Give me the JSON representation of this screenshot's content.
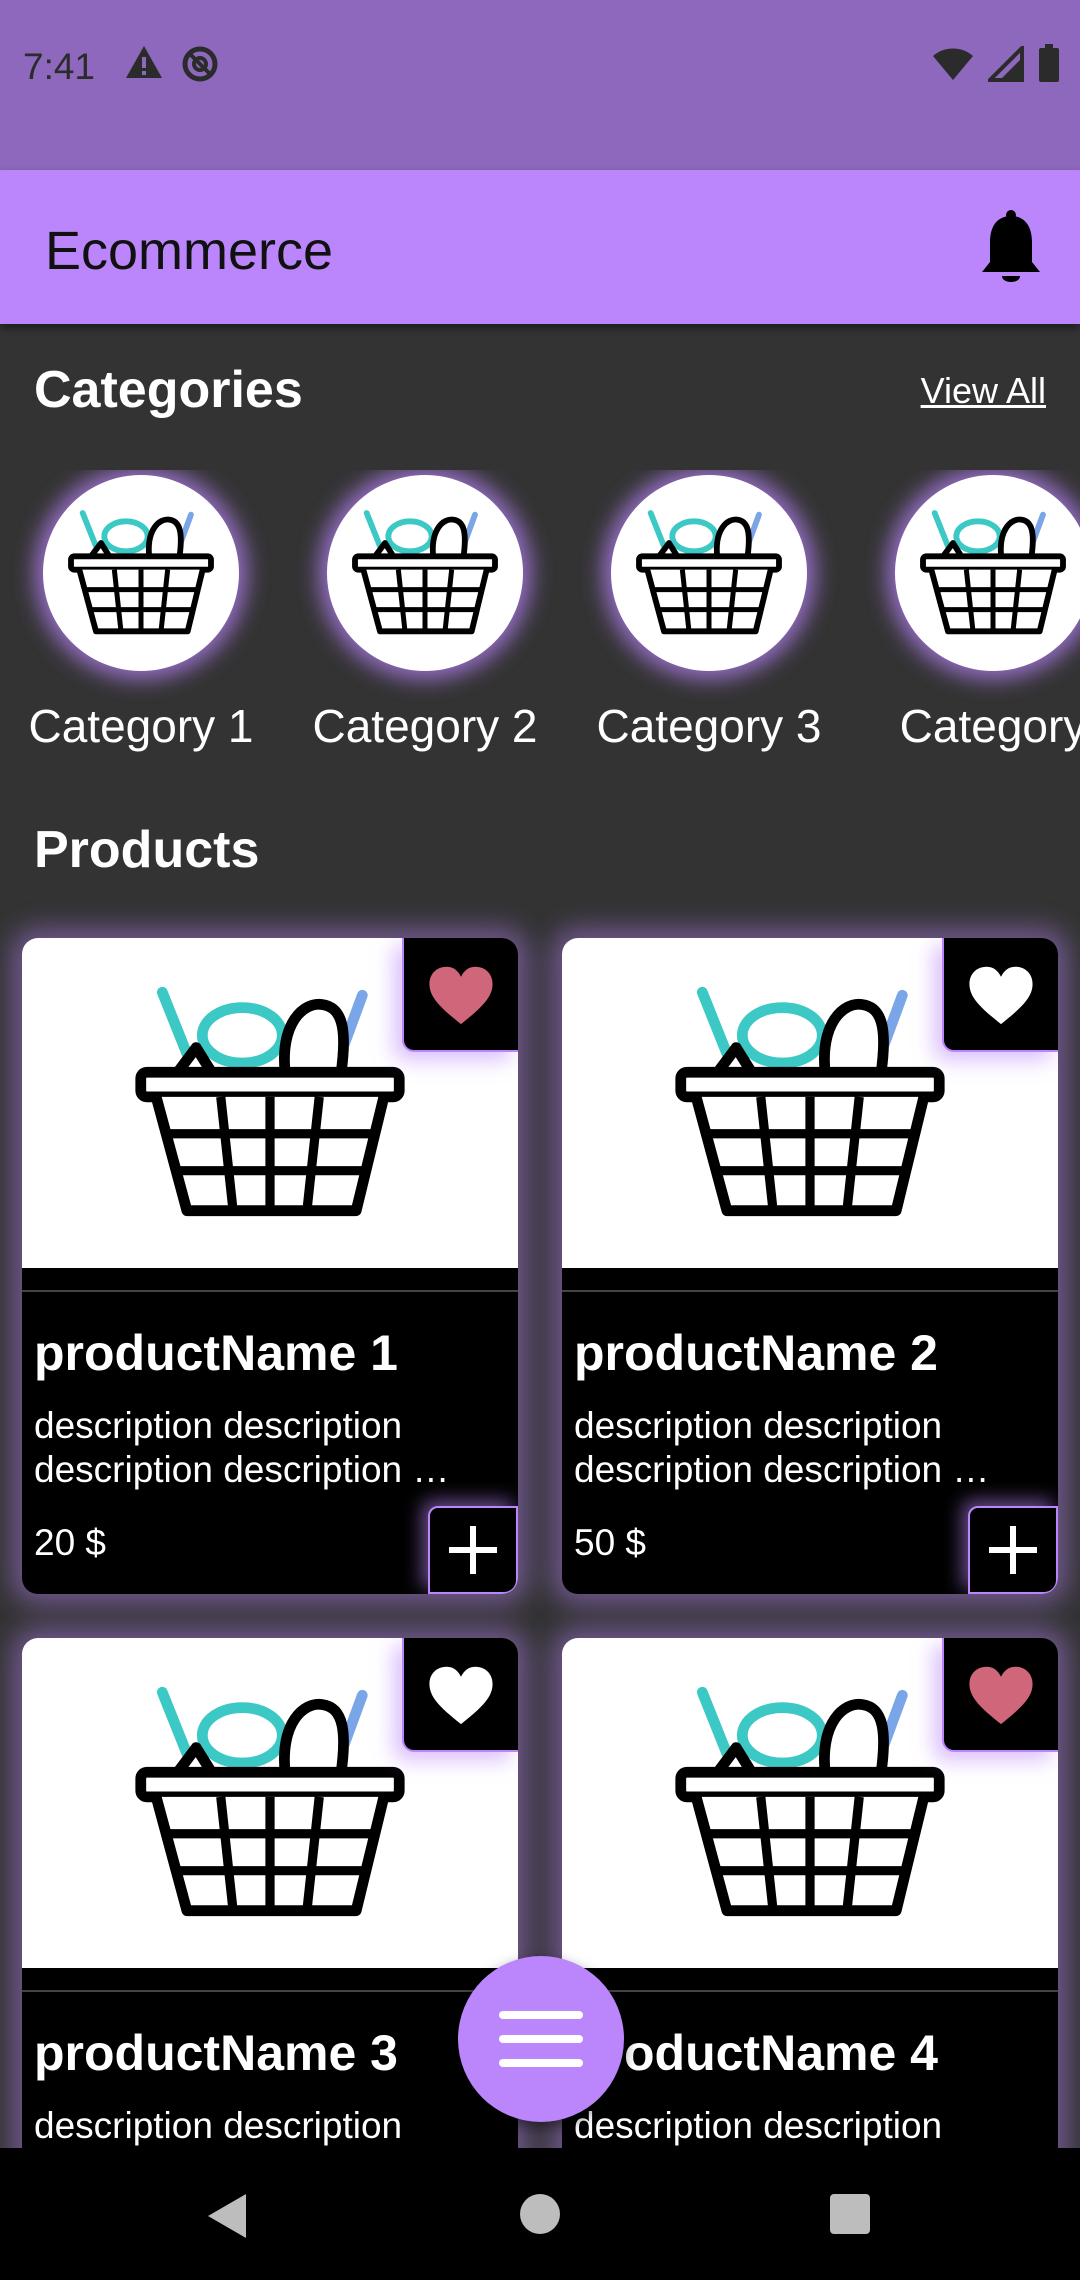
{
  "status_bar": {
    "time": "7:41",
    "left_icons": [
      "warning-icon",
      "do-not-disturb-icon"
    ],
    "right_icons": [
      "wifi-icon",
      "signal-icon",
      "battery-icon"
    ]
  },
  "app_bar": {
    "title": "Ecommerce",
    "notification_icon": "bell-icon"
  },
  "categories_section": {
    "title": "Categories",
    "view_all_label": "View All",
    "items": [
      {
        "label": "Category 1",
        "icon": "basket-icon"
      },
      {
        "label": "Category 2",
        "icon": "basket-icon"
      },
      {
        "label": "Category 3",
        "icon": "basket-icon"
      },
      {
        "label": "Category",
        "icon": "basket-icon"
      }
    ]
  },
  "products_section": {
    "title": "Products",
    "items": [
      {
        "name": "productName 1",
        "desc_line1": "description description",
        "desc_line2": "description description …",
        "price": "20 $",
        "favorite": true
      },
      {
        "name": "productName 2",
        "desc_line1": "description description",
        "desc_line2": "description description …",
        "price": "50 $",
        "favorite": false
      },
      {
        "name": "productName 3",
        "desc_line1": "description description",
        "desc_line2": "",
        "price": "",
        "favorite": false
      },
      {
        "name": "productName 4",
        "desc_line1": "description description",
        "desc_line2": "",
        "price": "",
        "favorite": true
      }
    ]
  },
  "fab": {
    "icon": "menu-icon"
  },
  "nav_bar": {
    "buttons": [
      "back-icon",
      "home-icon",
      "recents-icon"
    ]
  },
  "colors": {
    "status_bar": "#8e68bd",
    "app_bar": "#bb86fc",
    "background": "#333333",
    "card": "#000000",
    "favorite_active": "#cf6679",
    "favorite_inactive": "#ffffff"
  }
}
